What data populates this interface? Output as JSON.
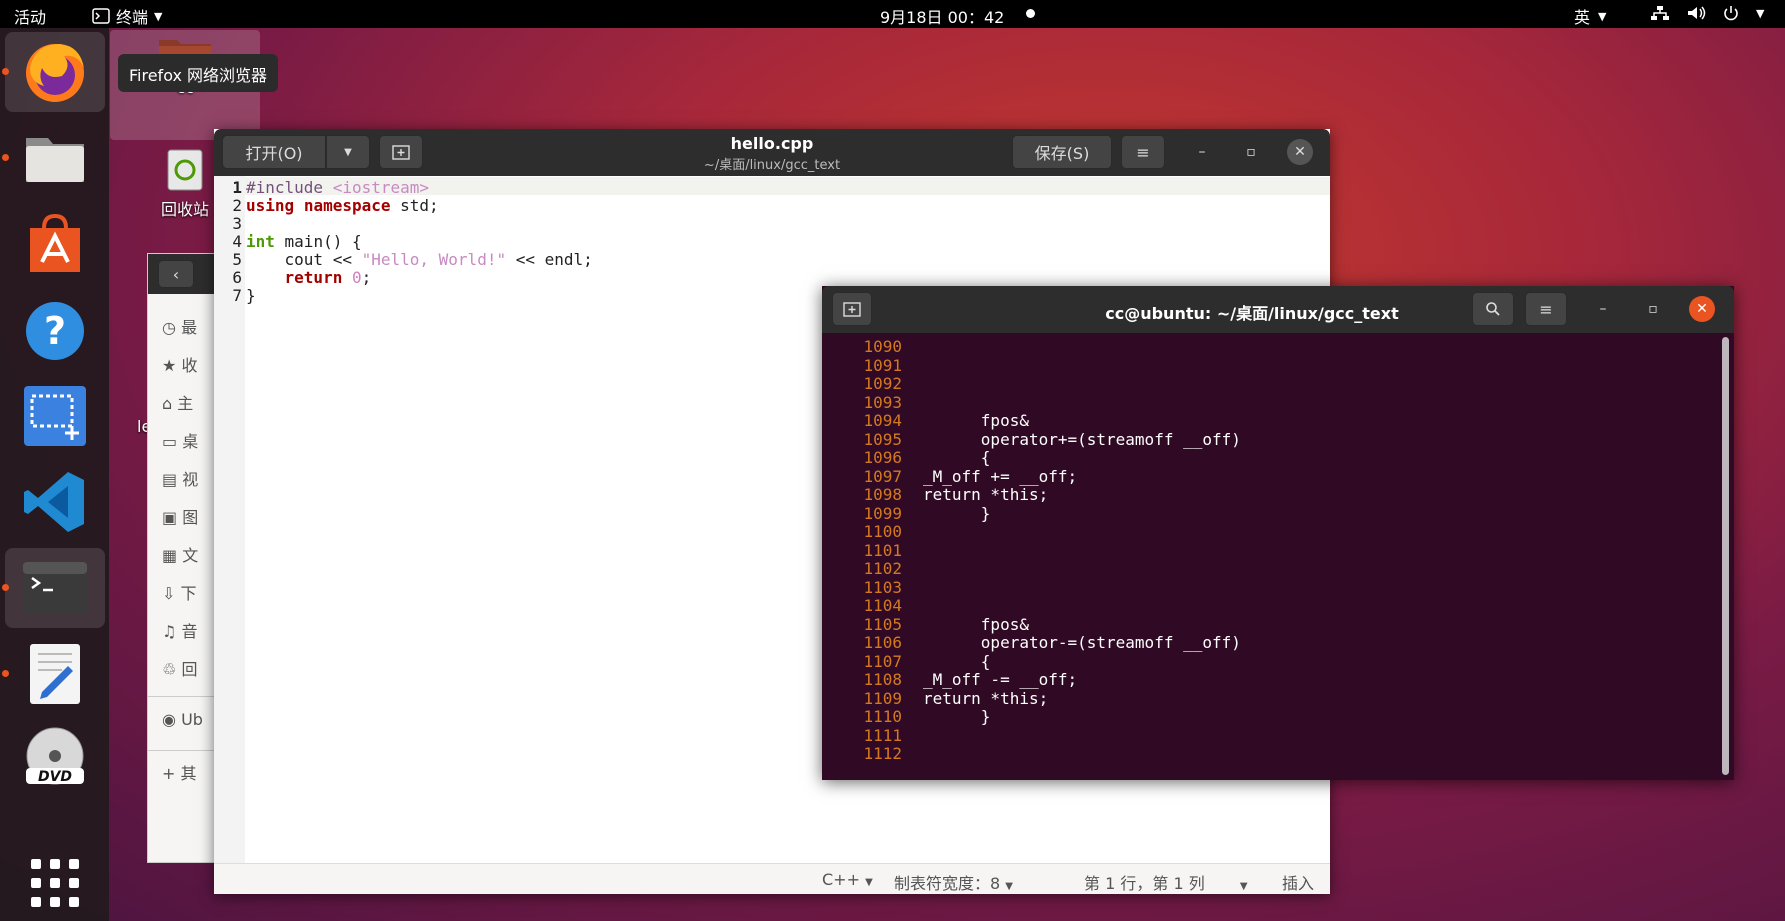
{
  "topbar": {
    "activities": "活动",
    "app_name": "终端",
    "clock": "9月18日  00：42",
    "input_method": "英"
  },
  "dock": {
    "tooltip": "Firefox 网络浏览器",
    "items": [
      "firefox",
      "files",
      "software",
      "help",
      "screenshot",
      "vscode",
      "terminal",
      "text-editor",
      "dvd",
      "app-grid"
    ]
  },
  "desktop": {
    "icons": [
      {
        "label": "cc"
      },
      {
        "label": "回收站"
      },
      {
        "label": "le"
      }
    ]
  },
  "files_window": {
    "sidebar": [
      "最",
      "收",
      "主",
      "桌",
      "视",
      "图",
      "文",
      "下",
      "音",
      "回",
      "Ub",
      "其"
    ]
  },
  "gedit": {
    "open_label": "打开(O)",
    "title": "hello.cpp",
    "subtitle": "~/桌面/linux/gcc_text",
    "save_label": "保存(S)",
    "line_numbers": [
      "1",
      "2",
      "3",
      "4",
      "5",
      "6",
      "7"
    ],
    "code": {
      "l1_kw": "#include",
      "l1_rest": " <iostream>",
      "l2_kw1": "using",
      "l2_kw2": "namespace",
      "l2_rest": " std;",
      "l4_kw": "int",
      "l4_rest": " main() {",
      "l5_pre": "    cout << ",
      "l5_str": "\"Hello, World!\"",
      "l5_post": " << endl;",
      "l6_kw": "return",
      "l6_num": "0",
      "l6_post": ";",
      "l7": "}"
    },
    "status": {
      "language": "C++",
      "tab_width": "制表符宽度：8",
      "position": "第 1 行，第 1 列",
      "mode": "插入"
    }
  },
  "terminal": {
    "title": "cc@ubuntu: ~/桌面/linux/gcc_text",
    "lines": [
      {
        "n": "1090",
        "t": ""
      },
      {
        "n": "1091",
        "t": ""
      },
      {
        "n": "1092",
        "t": ""
      },
      {
        "n": "1093",
        "t": ""
      },
      {
        "n": "1094",
        "t": "      fpos&"
      },
      {
        "n": "1095",
        "t": "      operator+=(streamoff __off)"
      },
      {
        "n": "1096",
        "t": "      {"
      },
      {
        "n": "1097",
        "t": "_M_off += __off;"
      },
      {
        "n": "1098",
        "t": "return *this;"
      },
      {
        "n": "1099",
        "t": "      }"
      },
      {
        "n": "1100",
        "t": ""
      },
      {
        "n": "1101",
        "t": ""
      },
      {
        "n": "1102",
        "t": ""
      },
      {
        "n": "1103",
        "t": ""
      },
      {
        "n": "1104",
        "t": ""
      },
      {
        "n": "1105",
        "t": "      fpos&"
      },
      {
        "n": "1106",
        "t": "      operator-=(streamoff __off)"
      },
      {
        "n": "1107",
        "t": "      {"
      },
      {
        "n": "1108",
        "t": "_M_off -= __off;"
      },
      {
        "n": "1109",
        "t": "return *this;"
      },
      {
        "n": "1110",
        "t": "      }"
      },
      {
        "n": "1111",
        "t": ""
      },
      {
        "n": "1112",
        "t": ""
      }
    ]
  },
  "colors": {
    "accent": "#e95420",
    "terminal_bg": "#300a24",
    "line_number": "#d4791f"
  }
}
